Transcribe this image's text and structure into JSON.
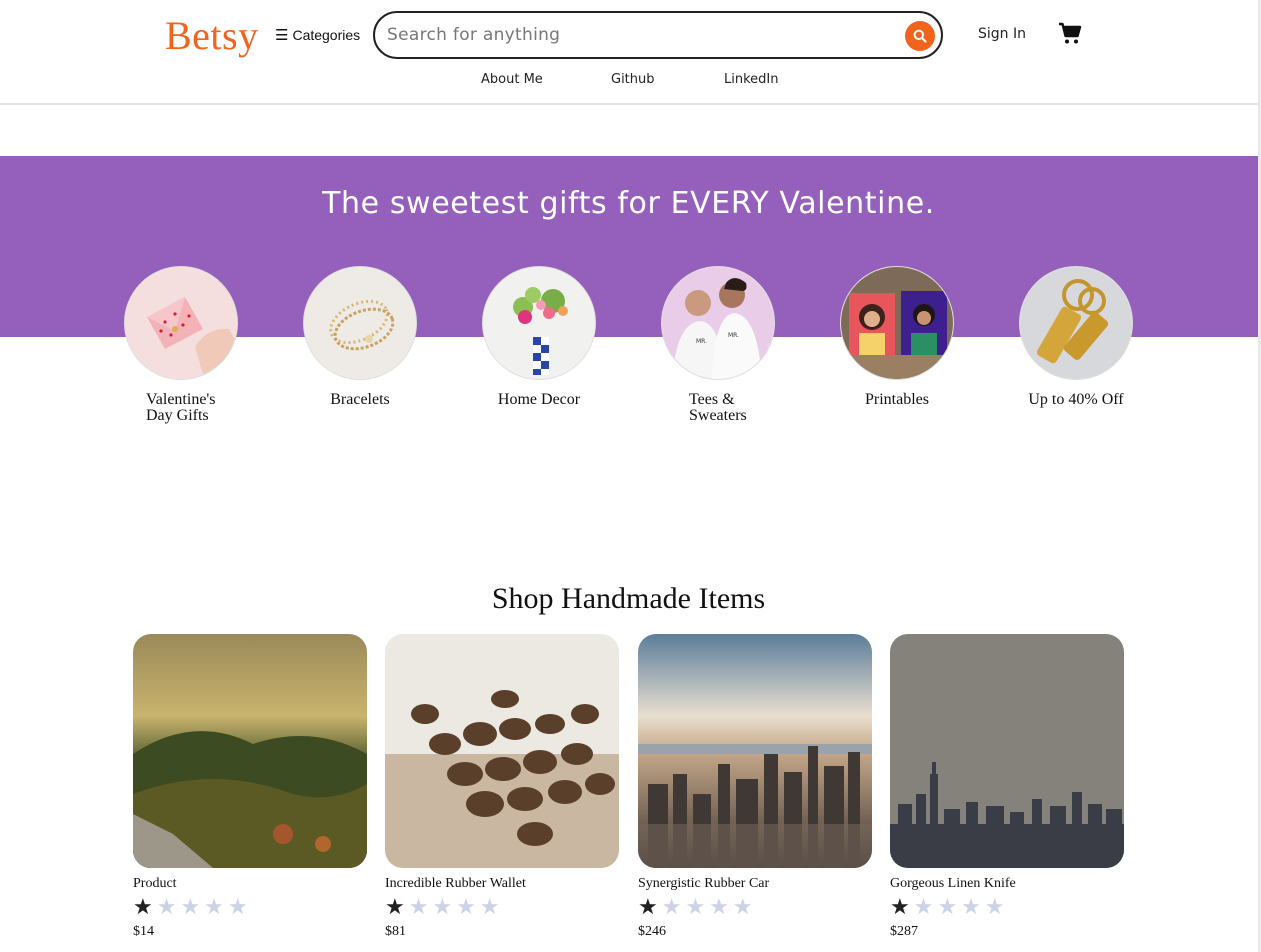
{
  "header": {
    "logo": "Betsy",
    "categories_label": "Categories",
    "search_placeholder": "Search for anything",
    "sign_in": "Sign In",
    "nav": [
      "About Me",
      "Github",
      "LinkedIn"
    ]
  },
  "banner": {
    "title": "The sweetest gifts for EVERY Valentine.",
    "color": "#9560bb",
    "categories": [
      {
        "label_line1": "Valentine's",
        "label_line2": "Day Gifts"
      },
      {
        "label_line1": "Bracelets",
        "label_line2": ""
      },
      {
        "label_line1": "Home Decor",
        "label_line2": ""
      },
      {
        "label_line1": "Tees &",
        "label_line2": "Sweaters"
      },
      {
        "label_line1": "Printables",
        "label_line2": ""
      },
      {
        "label_line1": "Up to 40% Off",
        "label_line2": ""
      }
    ]
  },
  "shop": {
    "title": "Shop Handmade Items",
    "items": [
      {
        "name": "Product",
        "rating": 1,
        "max_rating": 5,
        "price": "$14"
      },
      {
        "name": "Incredible Rubber Wallet",
        "rating": 1,
        "max_rating": 5,
        "price": "$81"
      },
      {
        "name": "Synergistic Rubber Car",
        "rating": 1,
        "max_rating": 5,
        "price": "$246"
      },
      {
        "name": "Gorgeous Linen Knife",
        "rating": 1,
        "max_rating": 5,
        "price": "$287"
      }
    ]
  },
  "colors": {
    "accent": "#f1641e",
    "banner": "#9560bb"
  }
}
